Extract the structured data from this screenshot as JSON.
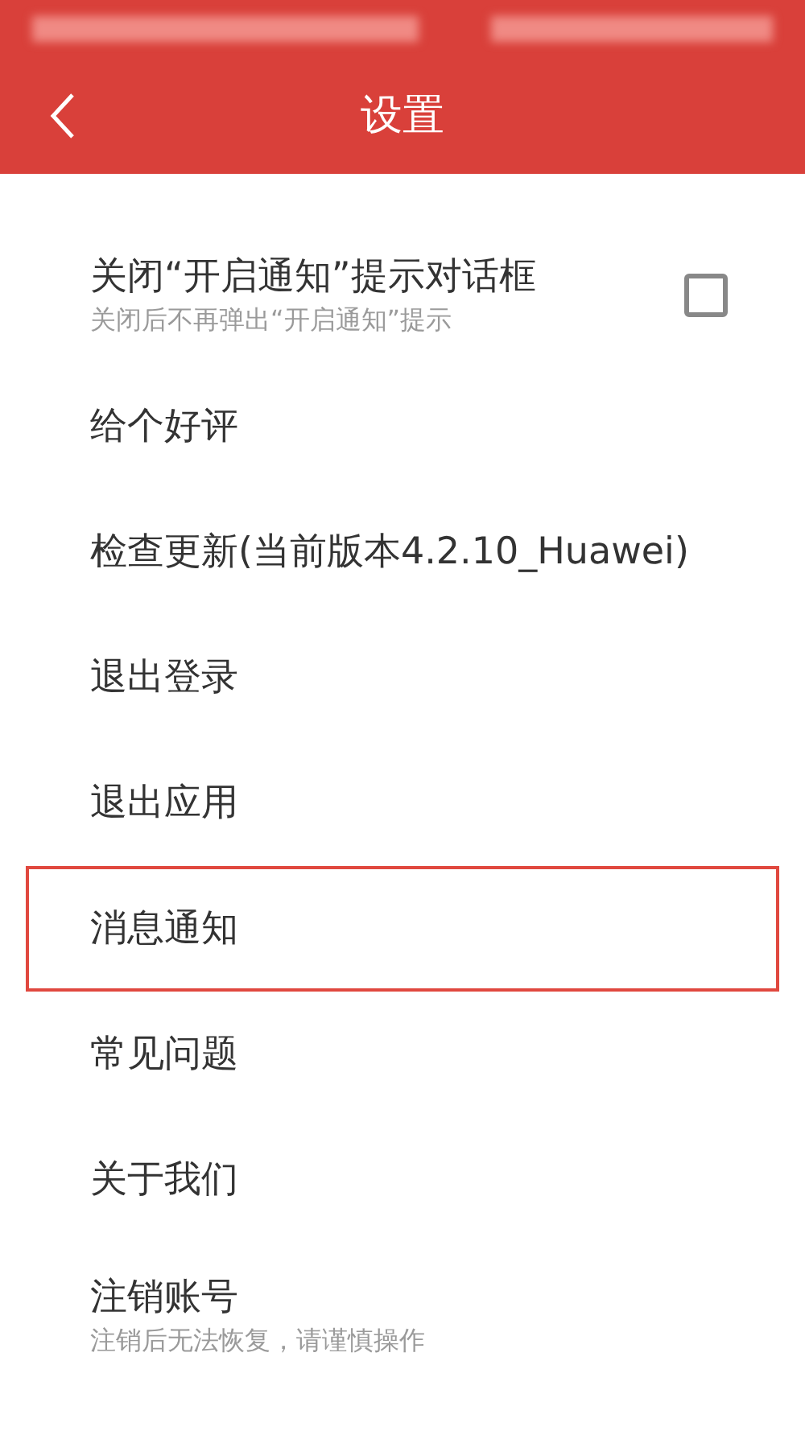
{
  "header": {
    "title": "设置"
  },
  "items": [
    {
      "kind": "checkbox",
      "label": "关闭“开启通知”提示对话框",
      "subtitle": "关闭后不再弹出“开启通知”提示",
      "checked": false,
      "highlighted": false
    },
    {
      "kind": "plain",
      "label": "给个好评",
      "highlighted": false
    },
    {
      "kind": "plain",
      "label": "检查更新(当前版本4.2.10_Huawei)",
      "highlighted": false
    },
    {
      "kind": "plain",
      "label": "退出登录",
      "highlighted": false
    },
    {
      "kind": "plain",
      "label": "退出应用",
      "highlighted": false
    },
    {
      "kind": "plain",
      "label": "消息通知",
      "highlighted": true
    },
    {
      "kind": "plain",
      "label": "常见问题",
      "highlighted": false
    },
    {
      "kind": "plain",
      "label": "关于我们",
      "highlighted": false
    },
    {
      "kind": "subtitle",
      "label": "注销账号",
      "subtitle": "注销后无法恢复，请谨慎操作",
      "highlighted": false
    }
  ]
}
